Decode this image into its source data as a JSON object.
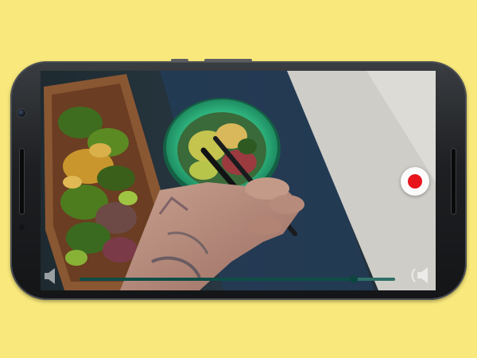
{
  "player": {
    "progress_fraction": 0.87,
    "recording": true
  },
  "icons": {
    "volume_left": "speaker-icon",
    "volume_right": "speaker-muted-icon",
    "record": "record-icon"
  },
  "colors": {
    "background": "#f9e97c",
    "record_red": "#e8141c",
    "progress_track": "#2f6f67",
    "bowl_green": "#2fb47e"
  }
}
